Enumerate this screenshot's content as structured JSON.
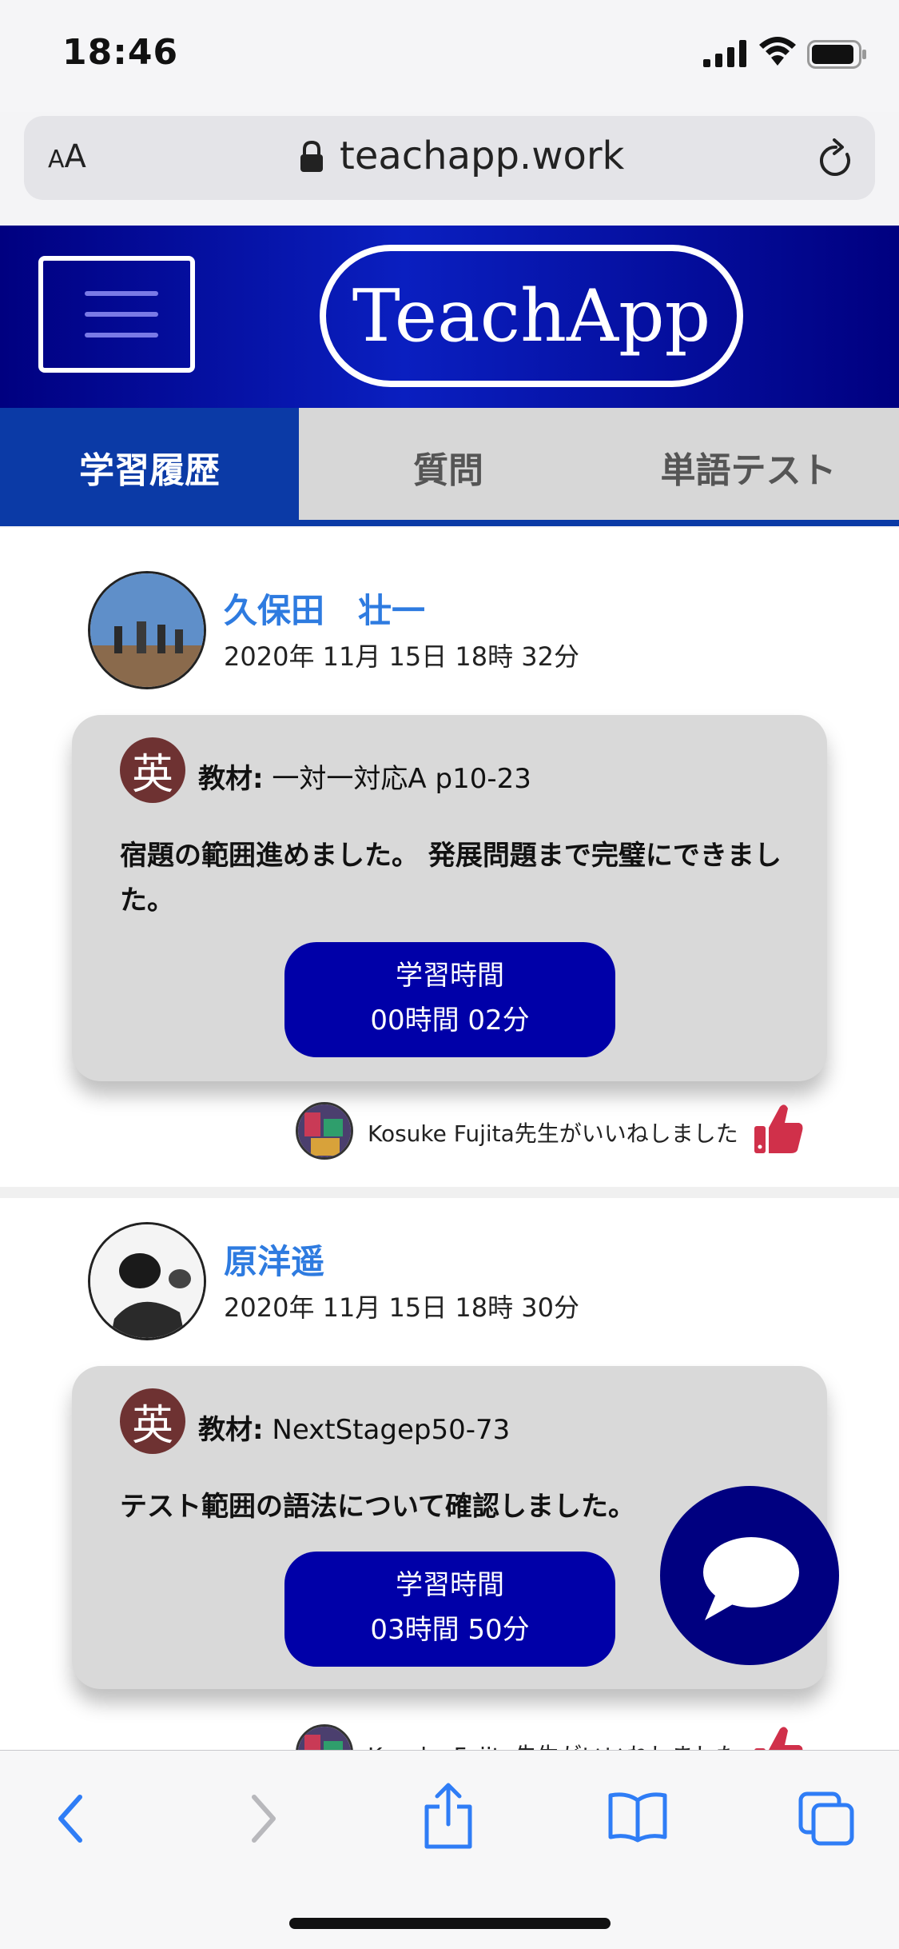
{
  "status_bar": {
    "time": "18:46"
  },
  "browser": {
    "aa_label_small": "A",
    "aa_label_large": "A",
    "url": "teachapp.work"
  },
  "app": {
    "logo": "TeachApp",
    "tabs": [
      {
        "label": "学習履歴",
        "active": true
      },
      {
        "label": "質問",
        "active": false
      },
      {
        "label": "単語テスト",
        "active": false
      }
    ]
  },
  "posts": [
    {
      "name": "久保田　壮一",
      "date": "2020年 11月 15日 18時 32分",
      "subject_icon": "英",
      "material_label": "教材:",
      "material": "一対一対応A p10-23",
      "comment": "宿題の範囲進めました。 発展問題まで完璧にできました。",
      "study_time_label": "学習時間",
      "study_time": "00時間 02分",
      "like_text": "Kosuke Fujita先生がいいねしました"
    },
    {
      "name": "原洋遥",
      "date": "2020年 11月 15日 18時 30分",
      "subject_icon": "英",
      "material_label": "教材:",
      "material": "NextStagep50-73",
      "comment": "テスト範囲の語法について確認しました。",
      "study_time_label": "学習時間",
      "study_time": "03時間 50分",
      "like_text": "Kosuke Fujita先生がいいねしました"
    }
  ],
  "colors": {
    "header_blue": "#000080",
    "tab_active": "#0b3aa6",
    "name_blue": "#2e7be0",
    "study_box": "#0000a8",
    "subject_icon": "#6e3232",
    "like_red": "#d0304a",
    "toolbar_blue": "#2f7df6"
  },
  "icons": {
    "menu": "hamburger-menu-icon",
    "chat": "speech-bubble-icon",
    "like": "thumbs-up-icon",
    "lock": "lock-icon",
    "reload": "reload-icon",
    "back": "chevron-left-icon",
    "forward": "chevron-right-icon",
    "share": "share-icon",
    "bookmarks": "book-icon",
    "tabs": "tabs-icon"
  }
}
